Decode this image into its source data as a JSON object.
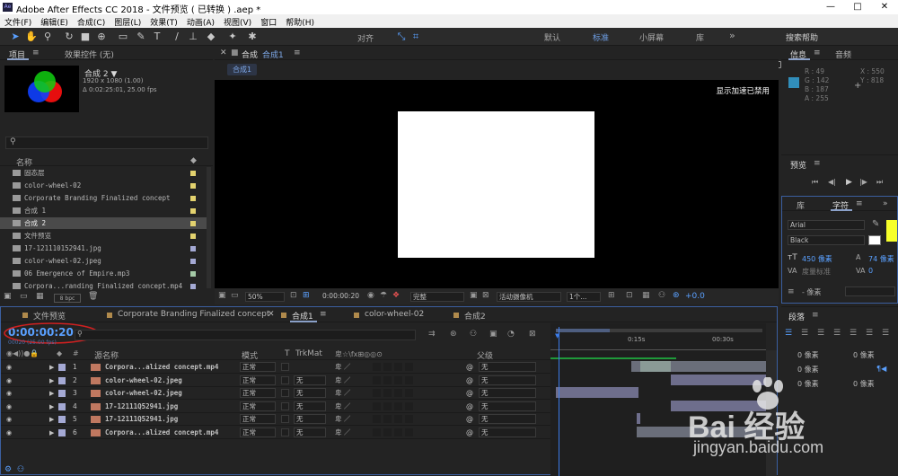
{
  "app": {
    "title": "Adobe After Effects CC 2018 - 文件预览 ( 已转换 ) .aep *",
    "win_min": "—",
    "win_max": "□",
    "win_close": "✕"
  },
  "menu": [
    "文件(F)",
    "编辑(E)",
    "合成(C)",
    "图层(L)",
    "效果(T)",
    "动画(A)",
    "视图(V)",
    "窗口",
    "帮助(H)"
  ],
  "toolbar": {
    "align_label": "对齐",
    "workspaces": [
      "默认",
      "标准",
      "小屏幕",
      "库"
    ],
    "active_workspace": "标准",
    "more": "»",
    "search_placeholder": "搜索帮助"
  },
  "project": {
    "tabs": [
      "项目",
      "效果控件 (无)"
    ],
    "comp_name": "合成 2 ▼",
    "comp_info1": "1920 x 1080 (1.00)",
    "comp_info2": "Δ 0:02:25:01, 25.00 fps",
    "col_name": "名称",
    "items": [
      {
        "name": "固态层",
        "color": "#e3d26e"
      },
      {
        "name": "color-wheel-02",
        "color": "#e3d26e"
      },
      {
        "name": "Corporate Branding  Finalized concept",
        "color": "#e3d26e"
      },
      {
        "name": "合成 1",
        "color": "#e3d26e"
      },
      {
        "name": "合成 2",
        "color": "#e3d26e"
      },
      {
        "name": "文件预览",
        "color": "#e3d26e"
      },
      {
        "name": "17-121110152941.jpg",
        "color": "#a4a9d4"
      },
      {
        "name": "color-wheel-02.jpeg",
        "color": "#a4a9d4"
      },
      {
        "name": "06 Emergence of Empire.mp3",
        "color": "#a4c9a6"
      },
      {
        "name": "Corpora...randing  Finalized concept.mp4",
        "color": "#a4a9d4"
      }
    ],
    "bpc": "8 bpc"
  },
  "comp_viewer": {
    "tab_label": "合成",
    "tab_active": "合成1",
    "breadcrumb": "合成1",
    "accel_notice": "显示加速已禁用",
    "zoom": "50%",
    "timecode": "0:00:00:20",
    "quality": "完整",
    "camera": "活动摄像机",
    "views": "1个...",
    "exposure": "+0.0"
  },
  "info": {
    "tabs": [
      "信息",
      "音频"
    ],
    "r": "R : 49",
    "g": "G : 142",
    "b": "B : 187",
    "a": "A : 255",
    "x": "X : 550",
    "y": "Y : 818",
    "swatch": "#318ebb"
  },
  "preview": {
    "title": "预览"
  },
  "character": {
    "tabs": [
      "库",
      "字符"
    ],
    "font": "Arial",
    "style": "Black",
    "size": "450 像素",
    "leading": "74 像素",
    "tracking": "度量标准",
    "px_unit": "- 像素"
  },
  "paragraph": {
    "title": "段落",
    "px_fields": [
      "0 像素",
      "0 像素",
      "0 像素",
      "0 像素",
      "0 像素"
    ]
  },
  "timeline": {
    "tabs": [
      "文件预览",
      "Corporate Branding  Finalized concept",
      "合成1",
      "color-wheel-02",
      "合成2"
    ],
    "tab_colors": [
      "#b08a4c",
      "#b08a4c",
      "#b08a4c",
      "#b08a4c",
      "#b08a4c"
    ],
    "active_tab": "合成1",
    "timecode": "0:00:00:20",
    "fps": "00020 (25.00 fps)",
    "col_source": "源名称",
    "col_mode": "模式",
    "col_t": "T",
    "col_trkmat": "TrkMat",
    "col_parent": "父级",
    "ruler": [
      "0:15s",
      "00:30s"
    ],
    "layers": [
      {
        "num": "1",
        "name": "Corpora...alized concept.mp4",
        "color": "#a4a9d4",
        "mode": "正常",
        "trkmat": "",
        "parent": "无"
      },
      {
        "num": "2",
        "name": "color-wheel-02.jpeg",
        "color": "#a4a9d4",
        "mode": "正常",
        "trkmat": "无",
        "parent": "无"
      },
      {
        "num": "3",
        "name": "color-wheel-02.jpeg",
        "color": "#a4a9d4",
        "mode": "正常",
        "trkmat": "无",
        "parent": "无"
      },
      {
        "num": "4",
        "name": "17-12111Q52941.jpg",
        "color": "#a4a9d4",
        "mode": "正常",
        "trkmat": "无",
        "parent": "无"
      },
      {
        "num": "5",
        "name": "17-12111Q52941.jpg",
        "color": "#a4a9d4",
        "mode": "正常",
        "trkmat": "无",
        "parent": "无"
      },
      {
        "num": "6",
        "name": "Corpora...alized concept.mp4",
        "color": "#a4a9d4",
        "mode": "正常",
        "trkmat": "无",
        "parent": "无"
      }
    ]
  },
  "watermark": {
    "brand": "Bai 经验",
    "url": "jingyan.baidu.com"
  }
}
